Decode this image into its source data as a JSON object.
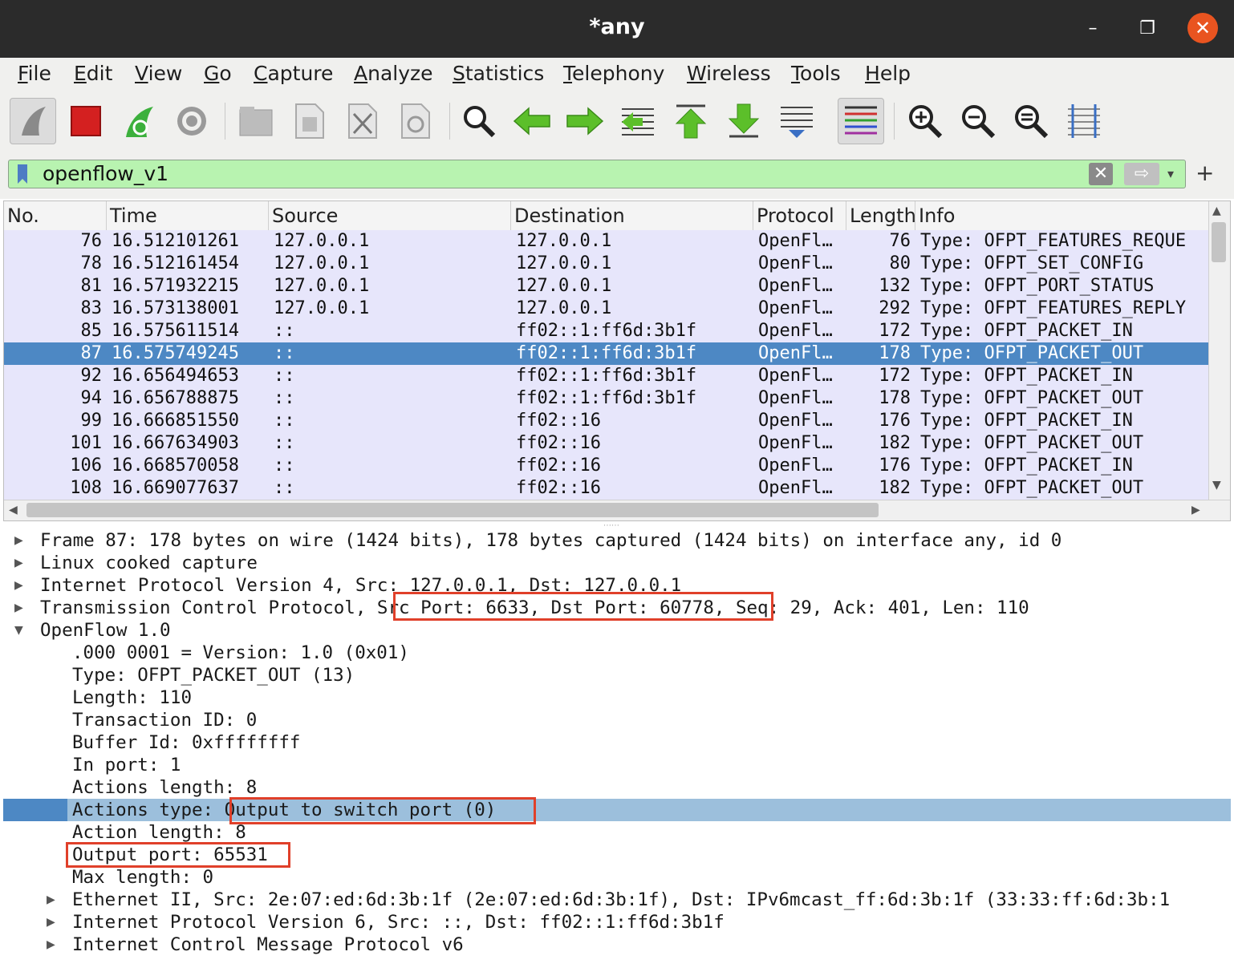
{
  "window": {
    "title": "*any",
    "minimize_label": "–",
    "restore_label": "❐",
    "close_label": "✕"
  },
  "menu": [
    "File",
    "Edit",
    "View",
    "Go",
    "Capture",
    "Analyze",
    "Statistics",
    "Telephony",
    "Wireless",
    "Tools",
    "Help"
  ],
  "toolbar": {
    "icons": [
      "shark-fin-start-icon",
      "stop-capture-icon",
      "restart-capture-icon",
      "capture-options-icon",
      "open-file-icon",
      "save-file-icon",
      "close-file-icon",
      "reload-file-icon",
      "find-packet-icon",
      "go-back-icon",
      "go-forward-icon",
      "go-to-packet-icon",
      "go-first-icon",
      "go-last-icon",
      "autoscroll-icon",
      "colorize-icon",
      "zoom-in-icon",
      "zoom-out-icon",
      "zoom-normal-icon",
      "resize-columns-icon"
    ]
  },
  "filter": {
    "value": "openflow_v1",
    "clear_label": "✕",
    "apply_label": "⇨",
    "dropdown_label": "▾",
    "add_label": "+"
  },
  "packet_list": {
    "columns": [
      "No.",
      "Time",
      "Source",
      "Destination",
      "Protocol",
      "Length",
      "Info"
    ],
    "rows": [
      {
        "no": "76",
        "time": "16.512101261",
        "src": "127.0.0.1",
        "dst": "127.0.0.1",
        "proto": "OpenFl…",
        "len": "76",
        "info": "Type: OFPT_FEATURES_REQUE"
      },
      {
        "no": "78",
        "time": "16.512161454",
        "src": "127.0.0.1",
        "dst": "127.0.0.1",
        "proto": "OpenFl…",
        "len": "80",
        "info": "Type: OFPT_SET_CONFIG"
      },
      {
        "no": "81",
        "time": "16.571932215",
        "src": "127.0.0.1",
        "dst": "127.0.0.1",
        "proto": "OpenFl…",
        "len": "132",
        "info": "Type: OFPT_PORT_STATUS"
      },
      {
        "no": "83",
        "time": "16.573138001",
        "src": "127.0.0.1",
        "dst": "127.0.0.1",
        "proto": "OpenFl…",
        "len": "292",
        "info": "Type: OFPT_FEATURES_REPLY"
      },
      {
        "no": "85",
        "time": "16.575611514",
        "src": "::",
        "dst": "ff02::1:ff6d:3b1f",
        "proto": "OpenFl…",
        "len": "172",
        "info": "Type: OFPT_PACKET_IN"
      },
      {
        "no": "87",
        "time": "16.575749245",
        "src": "::",
        "dst": "ff02::1:ff6d:3b1f",
        "proto": "OpenFl…",
        "len": "178",
        "info": "Type: OFPT_PACKET_OUT"
      },
      {
        "no": "92",
        "time": "16.656494653",
        "src": "::",
        "dst": "ff02::1:ff6d:3b1f",
        "proto": "OpenFl…",
        "len": "172",
        "info": "Type: OFPT_PACKET_IN"
      },
      {
        "no": "94",
        "time": "16.656788875",
        "src": "::",
        "dst": "ff02::1:ff6d:3b1f",
        "proto": "OpenFl…",
        "len": "178",
        "info": "Type: OFPT_PACKET_OUT"
      },
      {
        "no": "99",
        "time": "16.666851550",
        "src": "::",
        "dst": "ff02::16",
        "proto": "OpenFl…",
        "len": "176",
        "info": "Type: OFPT_PACKET_IN"
      },
      {
        "no": "101",
        "time": "16.667634903",
        "src": "::",
        "dst": "ff02::16",
        "proto": "OpenFl…",
        "len": "182",
        "info": "Type: OFPT_PACKET_OUT"
      },
      {
        "no": "106",
        "time": "16.668570058",
        "src": "::",
        "dst": "ff02::16",
        "proto": "OpenFl…",
        "len": "176",
        "info": "Type: OFPT_PACKET_IN"
      },
      {
        "no": "108",
        "time": "16.669077637",
        "src": "::",
        "dst": "ff02::16",
        "proto": "OpenFl…",
        "len": "182",
        "info": "Type: OFPT_PACKET_OUT"
      }
    ],
    "selected_row": "87"
  },
  "details": [
    {
      "text": "Frame 87: 178 bytes on wire (1424 bits), 178 bytes captured (1424 bits) on interface any, id 0",
      "expander": "▶"
    },
    {
      "text": "Linux cooked capture",
      "expander": "▶"
    },
    {
      "text": "Internet Protocol Version 4, Src: 127.0.0.1, Dst: 127.0.0.1",
      "expander": "▶"
    },
    {
      "text": "Transmission Control Protocol, Src Port: 6633, Dst Port: 60778, Seq: 29, Ack: 401, Len: 110",
      "expander": "▶"
    },
    {
      "text": "OpenFlow 1.0",
      "expander": "▼"
    },
    {
      "text": ".000 0001 = Version: 1.0 (0x01)",
      "expander": ""
    },
    {
      "text": "Type: OFPT_PACKET_OUT (13)",
      "expander": ""
    },
    {
      "text": "Length: 110",
      "expander": ""
    },
    {
      "text": "Transaction ID: 0",
      "expander": ""
    },
    {
      "text": "Buffer Id: 0xffffffff",
      "expander": ""
    },
    {
      "text": "In port: 1",
      "expander": ""
    },
    {
      "text": "Actions length: 8",
      "expander": ""
    },
    {
      "text": "Actions type: Output to switch port (0)",
      "expander": ""
    },
    {
      "text": "Action length: 8",
      "expander": ""
    },
    {
      "text": "Output port: 65531",
      "expander": ""
    },
    {
      "text": "Max length: 0",
      "expander": ""
    },
    {
      "text": "Ethernet II, Src: 2e:07:ed:6d:3b:1f (2e:07:ed:6d:3b:1f), Dst: IPv6mcast_ff:6d:3b:1f (33:33:ff:6d:3b:1",
      "expander": "▶"
    },
    {
      "text": "Internet Protocol Version 6, Src: ::, Dst: ff02::1:ff6d:3b1f",
      "expander": "▶"
    },
    {
      "text": "Internet Control Message Protocol v6",
      "expander": "▶"
    }
  ],
  "selected_detail": "Actions type: Output to switch port (0)",
  "colors": {
    "row_bg": "#e7e6fb",
    "selected_row": "#4d88c4",
    "filter_ok": "#b8f3b0",
    "highlight_box": "#e0402a"
  }
}
